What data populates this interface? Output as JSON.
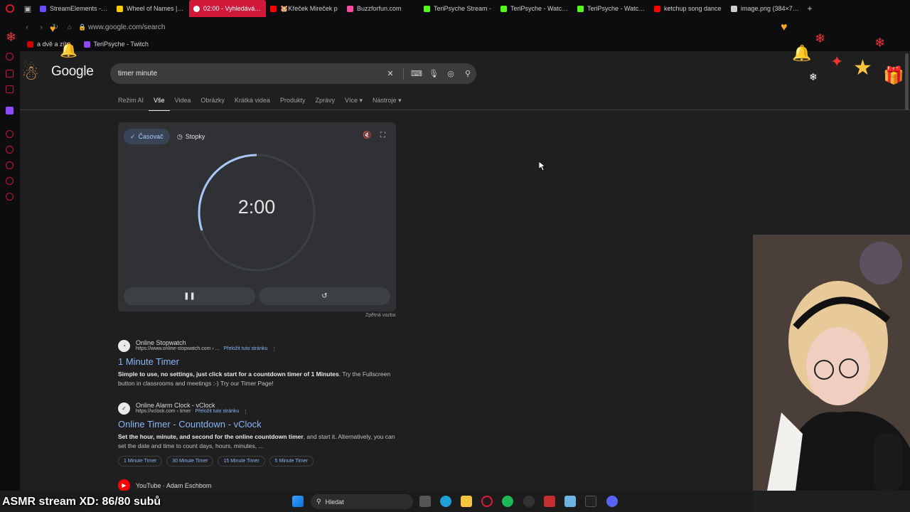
{
  "browser": {
    "tabs": [
      {
        "label": "StreamElements - Ac",
        "color": "#6a4bff",
        "active": false
      },
      {
        "label": "Wheel of Names | Ra",
        "color": "#ffcc00",
        "active": false
      },
      {
        "label": "02:00 - Vyhledávání Goog",
        "color": "#ffffff",
        "active": true
      },
      {
        "label": "🐹Křeček Mireček p",
        "color": "#ff0000",
        "active": false
      },
      {
        "label": "Buzzforfun.com",
        "color": "#ff4aa3",
        "active": false
      },
      {
        "label": "TeriPsyche Stream -",
        "color": "#53fc18",
        "active": false
      },
      {
        "label": "TeriPsyche - Watch c",
        "color": "#53fc18",
        "active": false
      },
      {
        "label": "TeriPsyche - Watch c",
        "color": "#53fc18",
        "active": false
      },
      {
        "label": "ketchup song dance",
        "color": "#ff0000",
        "active": false
      },
      {
        "label": "image.png (384×736)",
        "color": "#cccccc",
        "active": false
      }
    ],
    "url": "www.google.com/search",
    "bookmarks": [
      {
        "label": "a dvě a zítr...",
        "color": "#cc0000"
      },
      {
        "label": "TeriPsyche - Twitch",
        "color": "#9146ff"
      }
    ]
  },
  "google": {
    "logo": "Google",
    "query": "timer minute",
    "tabs": [
      "Režim AI",
      "Vše",
      "Videa",
      "Obrázky",
      "Krátká videa",
      "Produkty",
      "Zprávy",
      "Více",
      "Nástroje"
    ],
    "active_tab": "Vše"
  },
  "timer": {
    "mode_timer": "Časovač",
    "mode_stopwatch": "Stopky",
    "time": "2:00",
    "progress": 0.3,
    "feedback": "Zpětná vazba"
  },
  "results": [
    {
      "site": "Online Stopwatch",
      "url": "https://www.online-stopwatch.com › ...",
      "translate": "Přeložit tuto stránku",
      "title": "1 Minute Timer",
      "snippet_bold": "Simple to use, no settings, just click start for a countdown timer of 1 Minutes",
      "snippet_rest": ". Try the Fullscreen button in classrooms and meetings :-) Try our Timer Page!"
    },
    {
      "site": "Online Alarm Clock - vClock",
      "url": "https://vclock.com › timer",
      "translate": "Přeložit tuto stránku",
      "title": "Online Timer - Countdown - vClock",
      "snippet_bold": "Set the hour, minute, and second for the online countdown timer",
      "snippet_rest": ", and start it. Alternatively, you can set the date and time to count days, hours, minutes, ...",
      "chips": [
        "1 Minute Timer",
        "30 Minute Timer",
        "15 Minute Timer",
        "5 Minute Timer"
      ]
    },
    {
      "site": "YouTube · Adam Eschbom"
    }
  ],
  "stream": {
    "overlay_text": "ASMR stream XD: 86/80 subů"
  },
  "taskbar": {
    "search_placeholder": "Hledat"
  }
}
